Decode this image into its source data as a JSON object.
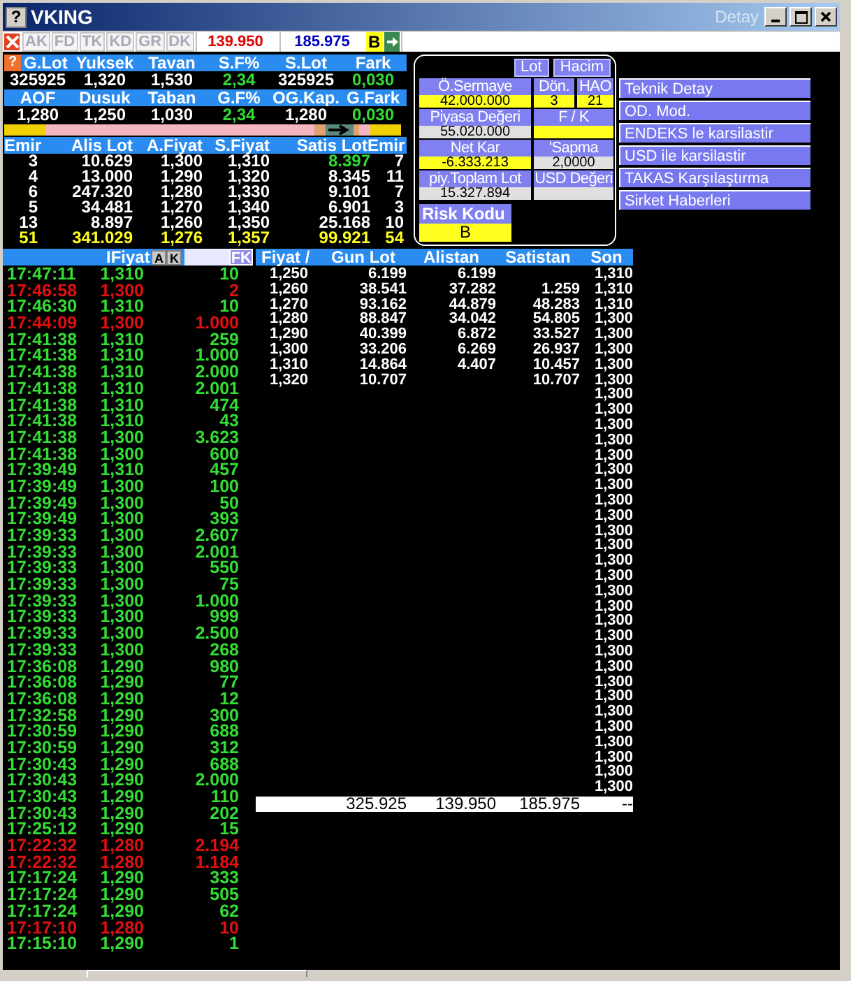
{
  "window": {
    "help": "?",
    "title": "VKING",
    "subtitle": "Detay"
  },
  "toolbar": {
    "tabs": [
      {
        "label": "AK",
        "disabled": true
      },
      {
        "label": "FD",
        "disabled": true
      },
      {
        "label": "TK",
        "disabled": true
      },
      {
        "label": "KD",
        "disabled": true
      },
      {
        "label": "GR",
        "disabled": true
      },
      {
        "label": "DK",
        "disabled": true
      }
    ],
    "fields": [
      {
        "value": "139.950",
        "color": "#e00000"
      },
      {
        "value": "185.975",
        "color": "#0000c0"
      }
    ],
    "flag": "B"
  },
  "summary": [
    {
      "help": "?",
      "headers": [
        "G.Lot",
        "Yuksek",
        "Tavan",
        "S.F%",
        "S.Lot",
        "Fark"
      ],
      "values": [
        {
          "text": "325925",
          "positive": false
        },
        {
          "text": "1,320",
          "positive": false
        },
        {
          "text": "1,530",
          "positive": false
        },
        {
          "text": "2,34",
          "positive": true
        },
        {
          "text": "325925",
          "positive": false
        },
        {
          "text": "0,030",
          "positive": true
        }
      ]
    },
    {
      "headers": [
        "AOF",
        "Dusuk",
        "Taban",
        "G.F%",
        "OG.Kap.",
        "G.Fark"
      ],
      "values": [
        {
          "text": "1,280",
          "positive": false
        },
        {
          "text": "1,250",
          "positive": false
        },
        {
          "text": "1,030",
          "positive": false
        },
        {
          "text": "2,34",
          "positive": true
        },
        {
          "text": "1,280",
          "positive": false
        },
        {
          "text": "0,030",
          "positive": true
        }
      ]
    }
  ],
  "order_book": {
    "columns": [
      "Emir",
      "Alis Lot",
      "A.Fiyat",
      "S.Fiyat",
      "Satis Lot",
      "Emir"
    ],
    "rows": [
      [
        {
          "text": "3",
          "color": "#ffffff"
        },
        {
          "text": "10.629",
          "color": "#ffffff"
        },
        {
          "text": "1,300",
          "color": "#ffffff"
        },
        {
          "text": "1,310",
          "color": "#ffffff"
        },
        {
          "text": "8.397",
          "color": "#33dd33"
        },
        {
          "text": "7",
          "color": "#ffffff"
        }
      ],
      [
        {
          "text": "4",
          "color": "#ffffff"
        },
        {
          "text": "13.000",
          "color": "#ffffff"
        },
        {
          "text": "1,290",
          "color": "#ffffff"
        },
        {
          "text": "1,320",
          "color": "#ffffff"
        },
        {
          "text": "8.345",
          "color": "#ffffff"
        },
        {
          "text": "11",
          "color": "#ffffff"
        }
      ],
      [
        {
          "text": "6",
          "color": "#ffffff"
        },
        {
          "text": "247.320",
          "color": "#ffffff"
        },
        {
          "text": "1,280",
          "color": "#ffffff"
        },
        {
          "text": "1,330",
          "color": "#ffffff"
        },
        {
          "text": "9.101",
          "color": "#ffffff"
        },
        {
          "text": "7",
          "color": "#ffffff"
        }
      ],
      [
        {
          "text": "5",
          "color": "#ffffff"
        },
        {
          "text": "34.481",
          "color": "#ffffff"
        },
        {
          "text": "1,270",
          "color": "#ffffff"
        },
        {
          "text": "1,340",
          "color": "#ffffff"
        },
        {
          "text": "6.901",
          "color": "#ffffff"
        },
        {
          "text": "3",
          "color": "#ffffff"
        }
      ],
      [
        {
          "text": "13",
          "color": "#ffffff"
        },
        {
          "text": "8.897",
          "color": "#ffffff"
        },
        {
          "text": "1,260",
          "color": "#ffffff"
        },
        {
          "text": "1,350",
          "color": "#ffffff"
        },
        {
          "text": "25.168",
          "color": "#ffffff"
        },
        {
          "text": "10",
          "color": "#ffffff"
        }
      ]
    ],
    "total": [
      "51",
      "341.029",
      "1,276",
      "1,357",
      "99.921",
      "54"
    ]
  },
  "details": {
    "toggles": [
      "Lot",
      "Hacim"
    ],
    "rows": [
      [
        {
          "label": "Ö.Sermaye",
          "value": "42.000.000",
          "color": "#ffff20"
        },
        {
          "label": "Dön.",
          "value": "3",
          "color": "#ffff20"
        },
        {
          "label": "HAO",
          "value": "21",
          "color": "#ffff20"
        }
      ],
      [
        {
          "label": "Piyasa Değeri",
          "value": "55.020.000",
          "color": "#e0e0e0"
        },
        {
          "label": "F / K",
          "color": "#ffff20"
        }
      ],
      [
        {
          "label": "Net Kar",
          "value": "-6.333.213",
          "color": "#ffff20"
        },
        {
          "label": "'Sapma",
          "value": "2,0000",
          "color": "#e0e0e0"
        }
      ],
      [
        {
          "label": "piy.Toplam Lot",
          "value": "15.327.894",
          "color": "#e0e0e0"
        },
        {
          "label": "USD Değeri",
          "color": "#e0e0e0"
        }
      ]
    ],
    "risk": {
      "label": "Risk Kodu",
      "value": "B"
    }
  },
  "menu": [
    "Teknik Detay",
    "OD. Mod.",
    "ENDEKS le karsilastir",
    "USD ile karsilastir",
    "TAKAS Karşılaştırma",
    "Sirket Haberleri"
  ],
  "trades_header": {
    "label": "IFiyat",
    "buttons": [
      "A",
      "K"
    ],
    "filter_button": "FK"
  },
  "trades": [
    {
      "time": "17:47:11",
      "price": "1,310",
      "lot": "10",
      "color": "#33dd33"
    },
    {
      "time": "17:46:58",
      "price": "1,300",
      "lot": "2",
      "color": "#e01010"
    },
    {
      "time": "17:46:30",
      "price": "1,310",
      "lot": "10",
      "color": "#33dd33"
    },
    {
      "time": "17:44:09",
      "price": "1,300",
      "lot": "1.000",
      "color": "#e01010"
    },
    {
      "time": "17:41:38",
      "price": "1,310",
      "lot": "259",
      "color": "#33dd33"
    },
    {
      "time": "17:41:38",
      "price": "1,310",
      "lot": "1.000",
      "color": "#33dd33"
    },
    {
      "time": "17:41:38",
      "price": "1,310",
      "lot": "2.000",
      "color": "#33dd33"
    },
    {
      "time": "17:41:38",
      "price": "1,310",
      "lot": "2.001",
      "color": "#33dd33"
    },
    {
      "time": "17:41:38",
      "price": "1,310",
      "lot": "474",
      "color": "#33dd33"
    },
    {
      "time": "17:41:38",
      "price": "1,310",
      "lot": "43",
      "color": "#33dd33"
    },
    {
      "time": "17:41:38",
      "price": "1,300",
      "lot": "3.623",
      "color": "#33dd33"
    },
    {
      "time": "17:41:38",
      "price": "1,300",
      "lot": "600",
      "color": "#33dd33"
    },
    {
      "time": "17:39:49",
      "price": "1,310",
      "lot": "457",
      "color": "#33dd33"
    },
    {
      "time": "17:39:49",
      "price": "1,300",
      "lot": "100",
      "color": "#33dd33"
    },
    {
      "time": "17:39:49",
      "price": "1,300",
      "lot": "50",
      "color": "#33dd33"
    },
    {
      "time": "17:39:49",
      "price": "1,300",
      "lot": "393",
      "color": "#33dd33"
    },
    {
      "time": "17:39:33",
      "price": "1,300",
      "lot": "2.607",
      "color": "#33dd33"
    },
    {
      "time": "17:39:33",
      "price": "1,300",
      "lot": "2.001",
      "color": "#33dd33"
    },
    {
      "time": "17:39:33",
      "price": "1,300",
      "lot": "550",
      "color": "#33dd33"
    },
    {
      "time": "17:39:33",
      "price": "1,300",
      "lot": "75",
      "color": "#33dd33"
    },
    {
      "time": "17:39:33",
      "price": "1,300",
      "lot": "1.000",
      "color": "#33dd33"
    },
    {
      "time": "17:39:33",
      "price": "1,300",
      "lot": "999",
      "color": "#33dd33"
    },
    {
      "time": "17:39:33",
      "price": "1,300",
      "lot": "2.500",
      "color": "#33dd33"
    },
    {
      "time": "17:39:33",
      "price": "1,300",
      "lot": "268",
      "color": "#33dd33"
    },
    {
      "time": "17:36:08",
      "price": "1,290",
      "lot": "980",
      "color": "#33dd33"
    },
    {
      "time": "17:36:08",
      "price": "1,290",
      "lot": "77",
      "color": "#33dd33"
    },
    {
      "time": "17:36:08",
      "price": "1,290",
      "lot": "12",
      "color": "#33dd33"
    },
    {
      "time": "17:32:58",
      "price": "1,290",
      "lot": "300",
      "color": "#33dd33"
    },
    {
      "time": "17:30:59",
      "price": "1,290",
      "lot": "688",
      "color": "#33dd33"
    },
    {
      "time": "17:30:59",
      "price": "1,290",
      "lot": "312",
      "color": "#33dd33"
    },
    {
      "time": "17:30:43",
      "price": "1,290",
      "lot": "688",
      "color": "#33dd33"
    },
    {
      "time": "17:30:43",
      "price": "1,290",
      "lot": "2.000",
      "color": "#33dd33"
    },
    {
      "time": "17:30:43",
      "price": "1,290",
      "lot": "110",
      "color": "#33dd33"
    },
    {
      "time": "17:30:43",
      "price": "1,290",
      "lot": "202",
      "color": "#33dd33"
    },
    {
      "time": "17:25:12",
      "price": "1,290",
      "lot": "15",
      "color": "#33dd33"
    },
    {
      "time": "17:22:32",
      "price": "1,280",
      "lot": "2.194",
      "color": "#e01010"
    },
    {
      "time": "17:22:32",
      "price": "1,280",
      "lot": "1.184",
      "color": "#e01010"
    },
    {
      "time": "17:17:24",
      "price": "1,290",
      "lot": "333",
      "color": "#33dd33"
    },
    {
      "time": "17:17:24",
      "price": "1,290",
      "lot": "505",
      "color": "#33dd33"
    },
    {
      "time": "17:17:24",
      "price": "1,290",
      "lot": "62",
      "color": "#33dd33"
    },
    {
      "time": "17:17:10",
      "price": "1,280",
      "lot": "10",
      "color": "#e01010"
    },
    {
      "time": "17:15:10",
      "price": "1,290",
      "lot": "1",
      "color": "#33dd33"
    }
  ],
  "price_table": {
    "columns": [
      "Fiyat /",
      "Gun Lot",
      "Alistan",
      "Satistan",
      "Son"
    ],
    "rows": [
      [
        "1,250",
        "6.199",
        "6.199",
        null
      ],
      [
        "1,260",
        "38.541",
        "37.282",
        "1.259"
      ],
      [
        "1,270",
        "93.162",
        "44.879",
        "48.283"
      ],
      [
        "1,280",
        "88.847",
        "34.042",
        "54.805"
      ],
      [
        "1,290",
        "40.399",
        "6.872",
        "33.527"
      ],
      [
        "1,300",
        "33.206",
        "6.269",
        "26.937"
      ],
      [
        "1,310",
        "14.864",
        "4.407",
        "10.457"
      ],
      [
        "1,320",
        "10.707",
        null,
        "10.707"
      ]
    ],
    "son": [
      "1,310",
      "1,310",
      "1,310",
      "1,300",
      "1,300",
      "1,300",
      "1,300",
      "1,300",
      "1,300",
      "1,300",
      "1,300",
      "1,300",
      "1,300",
      "1,300",
      "1,300",
      "1,300",
      "1,300",
      "1,300",
      "1,300",
      "1,300",
      "1,300",
      "1,300",
      "1,300",
      "1,300",
      "1,300",
      "1,300",
      "1,300",
      "1,300",
      "1,300",
      "1,300",
      "1,300",
      "1,300",
      "1,300",
      "1,300",
      "1,300"
    ],
    "totals": [
      "325.925",
      "139.950",
      "185.975",
      "--"
    ]
  }
}
